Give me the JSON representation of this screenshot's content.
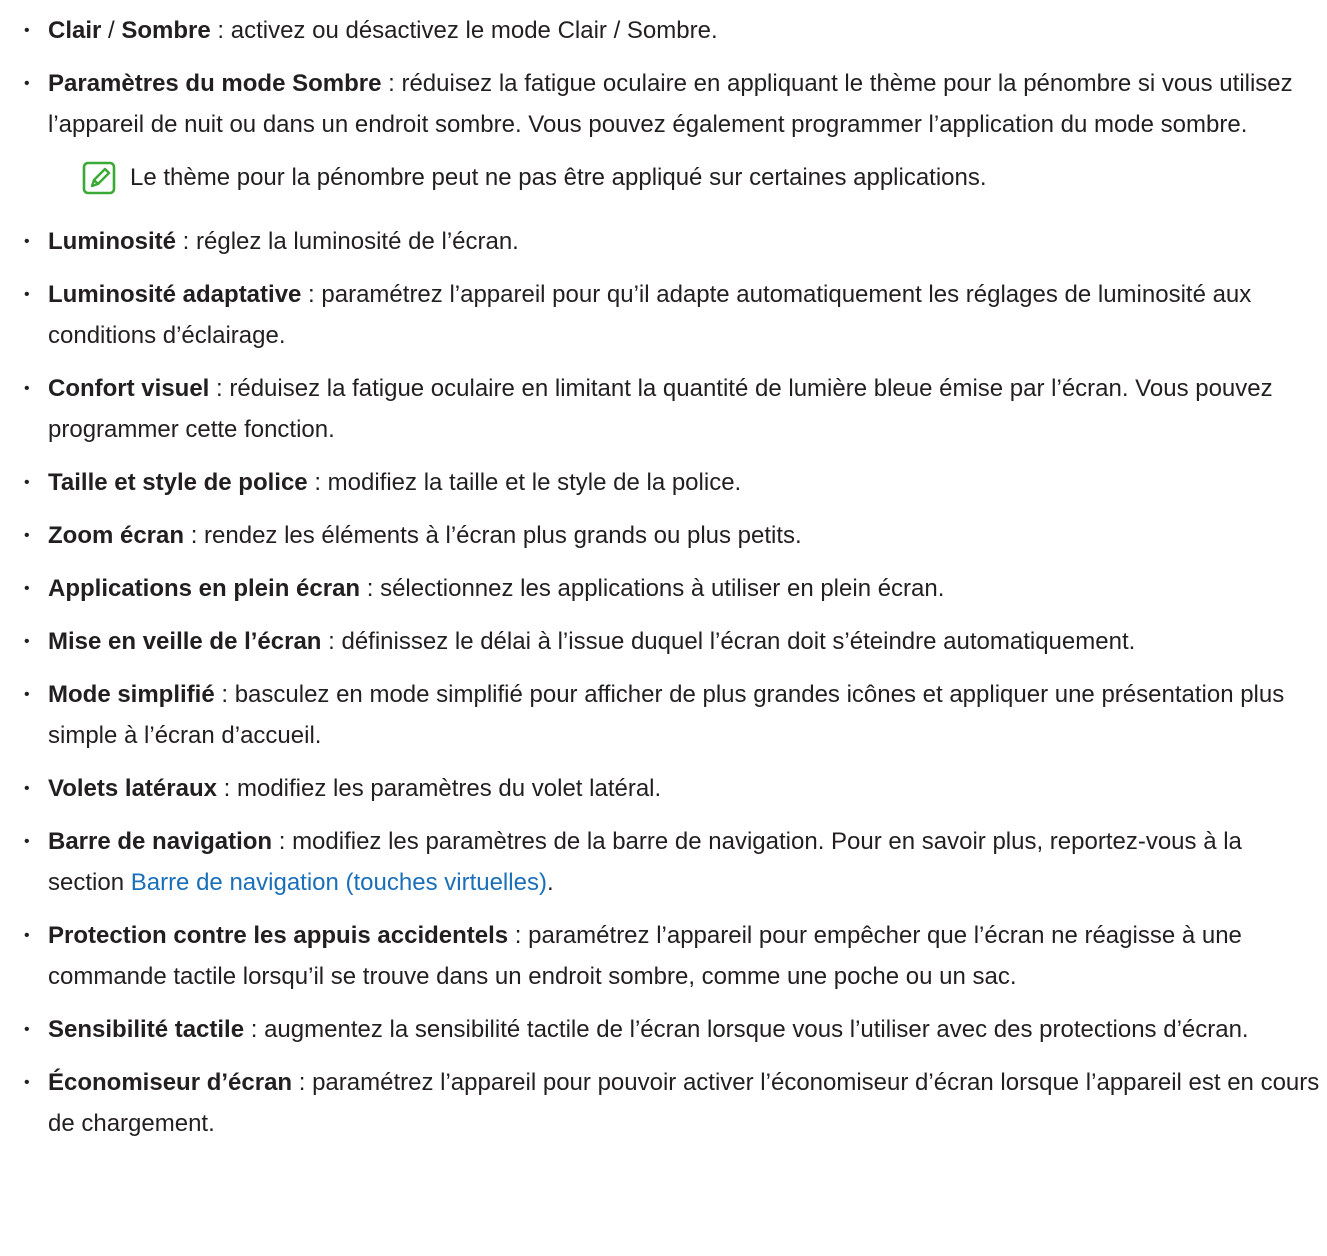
{
  "items": [
    {
      "a_term": "Clair",
      "sep": " / ",
      "b_term": "Sombre",
      "desc": " : activez ou désactivez le mode Clair / Sombre."
    },
    {
      "term": "Paramètres du mode Sombre",
      "desc": " : réduisez la fatigue oculaire en appliquant le thème pour la pénombre si vous utilisez l’appareil de nuit ou dans un endroit sombre. Vous pouvez également programmer l’application du mode sombre."
    },
    {
      "term": "Luminosité",
      "desc": " : réglez la luminosité de l’écran."
    },
    {
      "term": "Luminosité adaptative",
      "desc": " : paramétrez l’appareil pour qu’il adapte automatiquement les réglages de luminosité aux conditions d’éclairage."
    },
    {
      "term": "Confort visuel",
      "desc": " : réduisez la fatigue oculaire en limitant la quantité de lumière bleue émise par l’écran. Vous pouvez programmer cette fonction."
    },
    {
      "term": "Taille et style de police",
      "desc": " : modifiez la taille et le style de la police."
    },
    {
      "term": "Zoom écran",
      "desc": " : rendez les éléments à l’écran plus grands ou plus petits."
    },
    {
      "term": "Applications en plein écran",
      "desc": " : sélectionnez les applications à utiliser en plein écran."
    },
    {
      "term": "Mise en veille de l’écran",
      "desc": " : définissez le délai à l’issue duquel l’écran doit s’éteindre automatiquement."
    },
    {
      "term": "Mode simplifié",
      "desc": " : basculez en mode simplifié pour afficher de plus grandes icônes et appliquer une présentation plus simple à l’écran d’accueil."
    },
    {
      "term": "Volets latéraux",
      "desc": " : modifiez les paramètres du volet latéral."
    },
    {
      "term": "Barre de navigation",
      "desc": " : modifiez les paramètres de la barre de navigation. Pour en savoir plus, reportez-vous à la section ",
      "link": "Barre de navigation (touches virtuelles)",
      "after": "."
    },
    {
      "term": "Protection contre les appuis accidentels",
      "desc": " : paramétrez l’appareil pour empêcher que l’écran ne réagisse à une commande tactile lorsqu’il se trouve dans un endroit sombre, comme une poche ou un sac."
    },
    {
      "term": "Sensibilité tactile",
      "desc": " : augmentez la sensibilité tactile de l’écran lorsque vous l’utiliser avec des protections d’écran."
    },
    {
      "term": "Économiseur d’écran",
      "desc": " : paramétrez l’appareil pour pouvoir activer l’économiseur d’écran lorsque l’appareil est en cours de chargement."
    }
  ],
  "note": {
    "icon": "note-pencil-icon",
    "text": "Le thème pour la pénombre peut ne pas être appliqué sur certaines applications."
  },
  "bullet": "•",
  "colors": {
    "text": "#231f20",
    "link": "#1a6fb9",
    "icon": "#3aa935"
  }
}
